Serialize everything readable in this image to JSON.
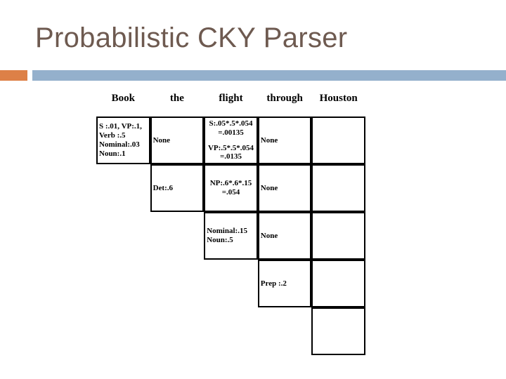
{
  "slide": {
    "title": "Probabilistic CKY Parser",
    "accent_color": "#dd8047",
    "bar_color": "#94b0cc",
    "title_color": "#6e5a50"
  },
  "table": {
    "columns": [
      "Book",
      "the",
      "flight",
      "through",
      "Houston"
    ],
    "rows": [
      {
        "index": 0,
        "cells": [
          {
            "col": 0,
            "align": "left",
            "groups": [
              [
                "S :.01, VP:.1,",
                "Verb :.5",
                "Nominal:.03",
                "Noun:.1"
              ]
            ]
          },
          {
            "col": 1,
            "align": "left",
            "groups": [
              [
                "None"
              ]
            ]
          },
          {
            "col": 2,
            "align": "center",
            "groups": [
              [
                "S:.05*.5*.054",
                "=.00135"
              ],
              [
                "VP:.5*.5*.054",
                "=.0135"
              ]
            ]
          },
          {
            "col": 3,
            "align": "left",
            "groups": [
              [
                "None"
              ]
            ]
          },
          {
            "col": 4,
            "align": "left",
            "groups": []
          }
        ]
      },
      {
        "index": 1,
        "cells": [
          {
            "col": 1,
            "align": "left",
            "groups": [
              [
                "Det:.6"
              ]
            ]
          },
          {
            "col": 2,
            "align": "center",
            "groups": [
              [
                "NP:.6*.6*.15",
                "=.054"
              ]
            ]
          },
          {
            "col": 3,
            "align": "left",
            "groups": [
              [
                "None"
              ]
            ]
          },
          {
            "col": 4,
            "align": "left",
            "groups": []
          }
        ]
      },
      {
        "index": 2,
        "cells": [
          {
            "col": 2,
            "align": "left",
            "groups": [
              [
                "Nominal:.15",
                "Noun:.5"
              ]
            ]
          },
          {
            "col": 3,
            "align": "left",
            "groups": [
              [
                "None"
              ]
            ]
          },
          {
            "col": 4,
            "align": "left",
            "groups": []
          }
        ]
      },
      {
        "index": 3,
        "cells": [
          {
            "col": 3,
            "align": "left",
            "groups": [
              [
                "Prep :.2"
              ]
            ]
          },
          {
            "col": 4,
            "align": "left",
            "groups": []
          }
        ]
      },
      {
        "index": 4,
        "cells": [
          {
            "col": 4,
            "align": "left",
            "groups": []
          }
        ]
      }
    ]
  }
}
